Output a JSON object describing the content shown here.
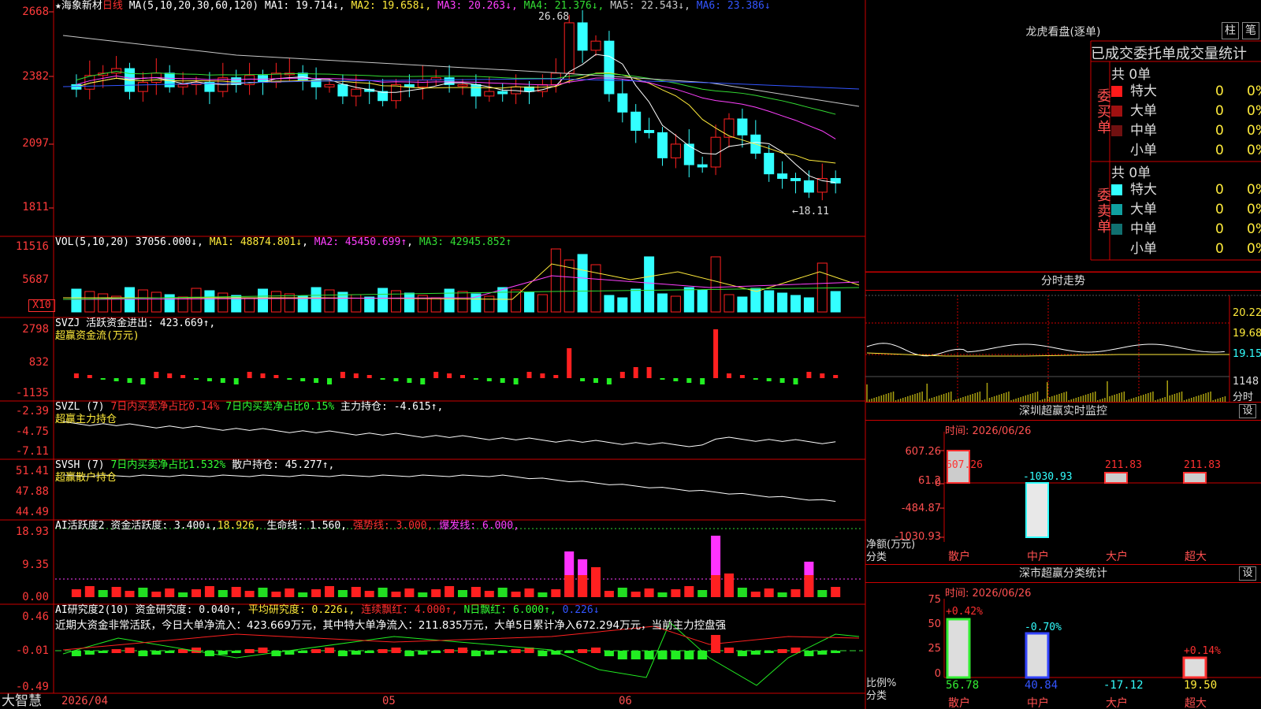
{
  "stock": {
    "star": "★",
    "name": "海象新材",
    "period": "日线"
  },
  "ma_header": {
    "label": "MA(5,10,20,30,60,120)",
    "items": [
      {
        "text": "MA1: 19.714↓",
        "color": "#ffffff"
      },
      {
        "text": "MA2: 19.658↓",
        "color": "#ffeb3b"
      },
      {
        "text": "MA3: 20.263↓",
        "color": "#ff40ff"
      },
      {
        "text": "MA4: 21.376↓",
        "color": "#33dd33"
      },
      {
        "text": "MA5: 22.543↓",
        "color": "#c8c8c8"
      },
      {
        "text": "MA6: 23.386↓",
        "color": "#3355ff"
      }
    ]
  },
  "price_axis": [
    "2668",
    "2382",
    "2097",
    "1811"
  ],
  "price_marks": {
    "high": "26.68",
    "low": "←18.11"
  },
  "vol_header": {
    "label": "VOL(5,10,20)",
    "value": "37056.000↓",
    "ma1": "MA1: 48874.801↓",
    "ma2": "MA2: 45450.699↑",
    "ma3": "MA3: 42945.852↑"
  },
  "vol_axis": [
    "11516",
    "5687"
  ],
  "vol_unit": "X10",
  "svzj_header": {
    "label": "SVZJ",
    "text": "活跃资金进出: 423.669↑,",
    "sub": "超赢资金流(万元)"
  },
  "svzj_axis": [
    "2798",
    "832",
    "-1135"
  ],
  "svzl_header": {
    "label": "SVZL (7)",
    "t1": "7日内买卖净占比0.14%",
    "t2": "7日内买卖净占比0.15%",
    "t3": "主力持仓: -4.615↑,",
    "sub": "超赢主力持仓"
  },
  "svzl_axis": [
    "-2.39",
    "-4.75",
    "-7.11"
  ],
  "svsh_header": {
    "label": "SVSH (7)",
    "t1": "7日内买卖净占比1.532%",
    "t2": "散户持仓: 45.277↑,",
    "sub": "超赢散户持仓"
  },
  "svsh_axis": [
    "51.41",
    "47.88",
    "44.49"
  ],
  "ai1_header": {
    "label": "AI活跃度2",
    "t1": "资金活跃度: 3.400↓,",
    "t2": "18.926,",
    "t3": "生命线: 1.560,",
    "t4": "强势线: 3.000,",
    "t5": "爆发线: 6.000,"
  },
  "ai1_axis": [
    "18.93",
    "9.35",
    "0.00"
  ],
  "ai2_header": {
    "label": "AI研究度2(10)",
    "t1": "资金研究度: 0.040↑,",
    "t2": "平均研究度: 0.226↓,",
    "t3": "连续飘红: 4.000↑,",
    "t4": "N日飘红: 6.000↑,",
    "t5": "0.226↓"
  },
  "ai2_text": "近期大资金非常活跃，今日大单净流入：423.669万元，其中特大单净流入：211.835万元，大单5日累计净入672.294万元，当前主力控盘强",
  "ai2_axis": [
    "0.46",
    "-0.01",
    "-0.49"
  ],
  "date_axis": {
    "brand": "大智慧",
    "d1": "2026/04",
    "d2": "05",
    "d3": "06"
  },
  "dragon": {
    "title": "龙虎看盘(逐单)",
    "btn1": "柱",
    "btn2": "笔",
    "subtitle": "已成交委托单成交量统计",
    "buy": {
      "label": "委买单",
      "total": "共 0单",
      "rows": [
        {
          "name": "特大",
          "v": "0",
          "p": "0%",
          "color": "#ff1a1a"
        },
        {
          "name": "大单",
          "v": "0",
          "p": "0%",
          "color": "#a01010"
        },
        {
          "name": "中单",
          "v": "0",
          "p": "0%",
          "color": "#701010"
        },
        {
          "name": "小单",
          "v": "0",
          "p": "0%",
          "color": "#000000"
        }
      ]
    },
    "sell": {
      "label": "委卖单",
      "total": "共 0单",
      "rows": [
        {
          "name": "特大",
          "v": "0",
          "p": "0%",
          "color": "#33ffff"
        },
        {
          "name": "大单",
          "v": "0",
          "p": "0%",
          "color": "#10a0a0"
        },
        {
          "name": "中单",
          "v": "0",
          "p": "0%",
          "color": "#107070"
        },
        {
          "name": "小单",
          "v": "0",
          "p": "0%",
          "color": "#000000"
        }
      ]
    }
  },
  "intraday": {
    "title": "分时走势",
    "axis": [
      "20.22",
      "19.68",
      "19.15"
    ],
    "vol_label": "1148",
    "tag": "分时"
  },
  "monitor": {
    "title": "深圳超赢实时监控",
    "set": "设",
    "date": "时间: 2026/06/26",
    "axis": [
      "607.26",
      "61.2",
      "0",
      "-484.87",
      "-1030.93"
    ],
    "ylabel": "净额(万元)",
    "xlabel": "分类",
    "cats": [
      "散户",
      "中户",
      "大户",
      "超大"
    ],
    "labels": [
      "607.26",
      "-1030.93",
      "211.83",
      "211.83"
    ]
  },
  "classify": {
    "title": "深市超赢分类统计",
    "set": "设",
    "date": "时间: 2026/06/26",
    "axis": [
      "75",
      "50",
      "25",
      "0"
    ],
    "ylabel": "比例%",
    "xlabel": "分类",
    "cats": [
      "散户",
      "中户",
      "大户",
      "超大"
    ],
    "top": [
      "+0.42%",
      "-0.70%",
      "",
      "+0.14%"
    ],
    "bottom": [
      "56.78",
      "40.84",
      "-17.12",
      "19.50"
    ]
  },
  "chart_data": {
    "type": "bar",
    "title": "",
    "x": "",
    "y": "",
    "price_candles_note": "",
    "monitor_values": [
      607.26,
      -1030.93,
      211.83,
      211.83
    ],
    "classify_values": [
      56.78,
      40.84,
      -17.12,
      19.5
    ],
    "ma_values": [
      19.714,
      19.658,
      20.263,
      21.376,
      22.543,
      23.386
    ]
  }
}
